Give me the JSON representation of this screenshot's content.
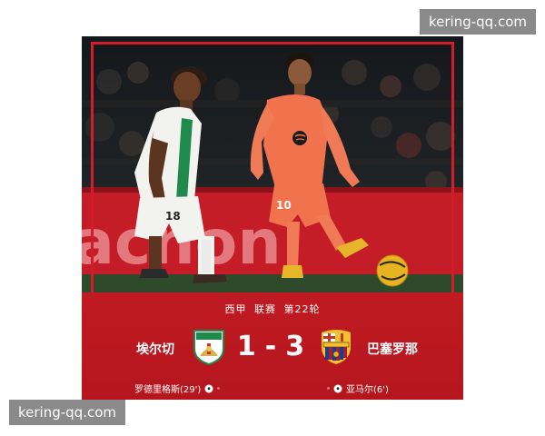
{
  "watermark": {
    "top": "kering-qq.com",
    "bottom": "kering-qq.com"
  },
  "match": {
    "competition": "西甲",
    "stage_type": "联赛",
    "round": "第22轮",
    "home": {
      "name": "埃尔切",
      "score": "1",
      "scorer": "罗德里格斯(29')",
      "crest_icon": "elche-crest-icon"
    },
    "away": {
      "name": "巴塞罗那",
      "score": "3",
      "scorer": "亚马尔(6')",
      "crest_icon": "barcelona-crest-icon"
    },
    "score_separator": "-"
  },
  "colors": {
    "panel_red": "#b8171f",
    "frame_red": "#d21d2a",
    "elche_green": "#1f8a4c",
    "barca_orange": "#f0734d",
    "ball_yellow": "#e8b320"
  }
}
